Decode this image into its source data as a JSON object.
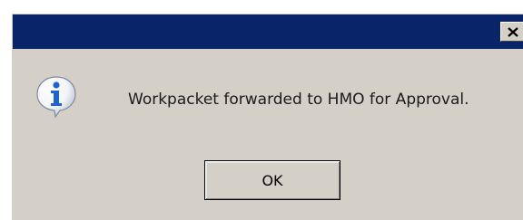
{
  "dialog": {
    "message": "Workpacket forwarded to HMO for Approval.",
    "ok_label": "OK",
    "close_glyph": "×",
    "icon": "info-icon"
  },
  "colors": {
    "titlebar": "#0a246a",
    "face": "#d4d0c8",
    "icon_blue": "#1e63d6"
  }
}
